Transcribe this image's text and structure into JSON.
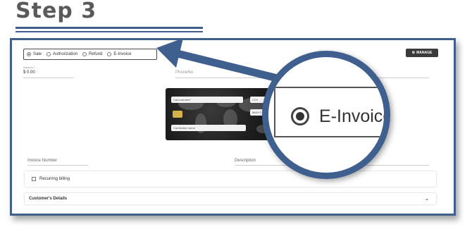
{
  "step_title": "Step 3",
  "transaction_types": {
    "sale": "Sale",
    "authorization": "Authorization",
    "refund": "Refund",
    "einvoice": "E-Invoice",
    "selected": "Sale"
  },
  "manage_label": "MANAGE",
  "amount": {
    "label": "Amount *",
    "currency": "$",
    "value": "0.00"
  },
  "phone_label": "PhoneNo",
  "card": {
    "number_placeholder": "Card number*",
    "cvv_placeholder": "CVV",
    "mmyy_placeholder": "MM/YY",
    "holder_placeholder": "Cardholder name"
  },
  "invoice_number_label": "Invoice Number",
  "description_label": "Description",
  "recurring_billing_label": "Recurring billing",
  "customer_details_label": "Customer's Details",
  "zoom": {
    "label": "E-Invoice"
  },
  "colors": {
    "accent": "#3f5f8f",
    "title": "#5a5a5a",
    "button": "#3a3a3a"
  }
}
